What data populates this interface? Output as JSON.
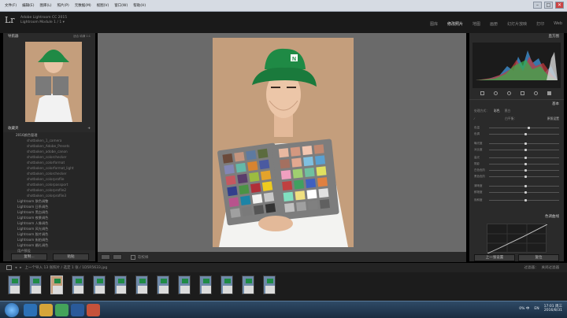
{
  "menubar": {
    "items": [
      "文件(F)",
      "编辑(E)",
      "图库(L)",
      "照片(P)",
      "元数据(M)",
      "视图(V)",
      "窗口(W)",
      "帮助(H)"
    ],
    "win_buttons": [
      "–",
      "□",
      "✕"
    ]
  },
  "identity": {
    "logo": "Lr",
    "line1": "Adobe Lightroom CC 2015",
    "line2": "Lightroom Module 1 / 1 ▾"
  },
  "modules": [
    "图库",
    "修改照片",
    "地图",
    "画册",
    "幻灯片放映",
    "打印",
    "Web"
  ],
  "left": {
    "navigator_title": "导航器",
    "navigator_zoom": "适合  填满  1:1",
    "collections_title": "收藏夹",
    "collections": [
      {
        "label": "2016颜色管理",
        "kind": "parent"
      },
      {
        "label": "shotboken_1_camera",
        "kind": "sub"
      },
      {
        "label": "shotboken_Adobe_Presets",
        "kind": "sub"
      },
      {
        "label": "shotboken_adobe_canon",
        "kind": "sub"
      },
      {
        "label": "shotboken_colorchecker",
        "kind": "sub"
      },
      {
        "label": "shotboken_colorformat",
        "kind": "sub"
      },
      {
        "label": "shotboken_colorformat_light",
        "kind": "sub"
      },
      {
        "label": "shotboken_colorchecker",
        "kind": "sub"
      },
      {
        "label": "shotboken_colorprofile",
        "kind": "sub"
      },
      {
        "label": "shotboken_colorpassport",
        "kind": "sub"
      },
      {
        "label": "shotboken_colorprofile2",
        "kind": "sub"
      },
      {
        "label": "shotboken_colorprofile3",
        "kind": "sub"
      },
      {
        "label": "Lightroom 肤色调整",
        "kind": "item"
      },
      {
        "label": "Lightroom 日系调色",
        "kind": "item"
      },
      {
        "label": "Lightroom 黑白调色",
        "kind": "item"
      },
      {
        "label": "Lightroom 夜景调色",
        "kind": "item"
      },
      {
        "label": "Lightroom 人像调色",
        "kind": "item"
      },
      {
        "label": "Lightroom 风光调色",
        "kind": "item"
      },
      {
        "label": "Lightroom 胶片调色",
        "kind": "item"
      },
      {
        "label": "Lightroom 街拍调色",
        "kind": "item"
      },
      {
        "label": "Lightroom 婚礼调色",
        "kind": "item"
      },
      {
        "label": "用户预设",
        "kind": "item"
      },
      {
        "label": "预设",
        "kind": "item"
      }
    ],
    "copy_button": "复制...",
    "paste_button": "粘贴"
  },
  "toolbar": {
    "label": "软校样"
  },
  "right": {
    "histogram_title": "直方图",
    "basic_title": "基本",
    "treatment": "处理方式：",
    "treatment_color": "彩色",
    "treatment_bw": "黑白",
    "wb_label": "白平衡：",
    "wb_value": "原照设置",
    "sliders": [
      {
        "label": "色温",
        "level": 0.55
      },
      {
        "label": "色调",
        "level": 0.5
      },
      {
        "label": "曝光度",
        "level": 0.5
      },
      {
        "label": "对比度",
        "level": 0.5
      },
      {
        "label": "高光",
        "level": 0.5
      },
      {
        "label": "阴影",
        "level": 0.5
      },
      {
        "label": "白色色阶",
        "level": 0.5
      },
      {
        "label": "黑色色阶",
        "level": 0.5
      },
      {
        "label": "清晰度",
        "level": 0.5
      },
      {
        "label": "鲜艳度",
        "level": 0.5
      },
      {
        "label": "饱和度",
        "level": 0.5
      }
    ],
    "tonecurve_title": "色调曲线",
    "prev_button": "上一张设置",
    "reset_button": "复位"
  },
  "filmstrip": {
    "bar_text": "上一个导入  13 张照片 / 选定 1 张 / 1D5R5633.jpg",
    "filter_label": "过滤器：",
    "filter_value": "关闭过滤器",
    "count": 13,
    "selected_index": 2
  },
  "taskbar": {
    "time": "17:01 周三",
    "date": "2016/8/31",
    "lang": "EN",
    "tray_text": "0% 中"
  },
  "colors": {
    "accent": "#cfcfcf",
    "panel": "#2a2a2a",
    "view_bg": "#6a6a6a",
    "hat_green": "#1f8a45"
  }
}
